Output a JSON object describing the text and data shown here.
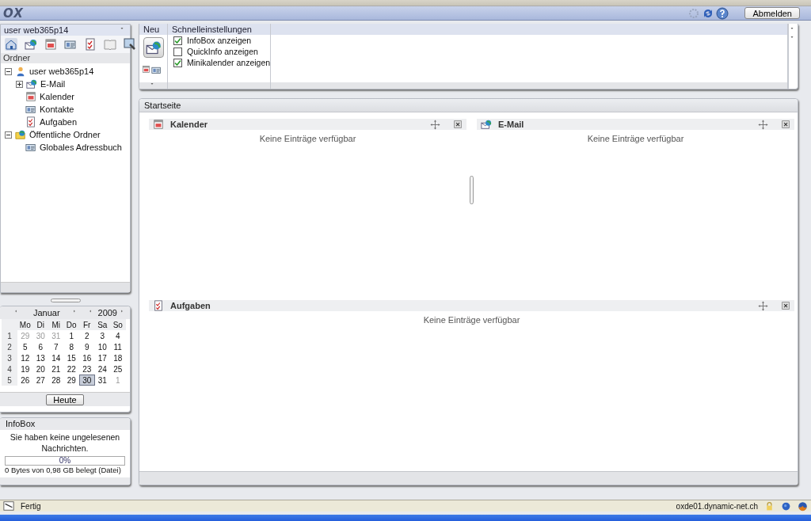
{
  "header": {
    "logo": "OX",
    "logout_button": "Abmelden"
  },
  "sidebar": {
    "account": "user web365p14",
    "folders_title": "Ordner",
    "tree": [
      {
        "label": "user web365p14",
        "kind": "user",
        "expanded": true,
        "children": [
          {
            "label": "E-Mail",
            "kind": "mail",
            "expanded": false
          },
          {
            "label": "Kalender",
            "kind": "calendar"
          },
          {
            "label": "Kontakte",
            "kind": "contacts"
          },
          {
            "label": "Aufgaben",
            "kind": "tasks"
          }
        ]
      },
      {
        "label": "Öffentliche Ordner",
        "kind": "public",
        "expanded": true,
        "children": [
          {
            "label": "Globales Adressbuch",
            "kind": "contacts"
          }
        ]
      }
    ]
  },
  "mini_calendar": {
    "month": "Januar",
    "year": "2009",
    "weekdays": [
      "Mo",
      "Di",
      "Mi",
      "Do",
      "Fr",
      "Sa",
      "So"
    ],
    "weeks": [
      {
        "number": "1",
        "days": [
          {
            "day": "29",
            "outside": true,
            "selected": false
          },
          {
            "day": "30",
            "outside": true,
            "selected": false
          },
          {
            "day": "31",
            "outside": true,
            "selected": false
          },
          {
            "day": "1",
            "outside": false,
            "selected": false
          },
          {
            "day": "2",
            "outside": false,
            "selected": false
          },
          {
            "day": "3",
            "outside": false,
            "selected": false
          },
          {
            "day": "4",
            "outside": false,
            "selected": false
          }
        ]
      },
      {
        "number": "2",
        "days": [
          {
            "day": "5",
            "outside": false,
            "selected": false
          },
          {
            "day": "6",
            "outside": false,
            "selected": false
          },
          {
            "day": "7",
            "outside": false,
            "selected": false
          },
          {
            "day": "8",
            "outside": false,
            "selected": false
          },
          {
            "day": "9",
            "outside": false,
            "selected": false
          },
          {
            "day": "10",
            "outside": false,
            "selected": false
          },
          {
            "day": "11",
            "outside": false,
            "selected": false
          }
        ]
      },
      {
        "number": "3",
        "days": [
          {
            "day": "12",
            "outside": false,
            "selected": false
          },
          {
            "day": "13",
            "outside": false,
            "selected": false
          },
          {
            "day": "14",
            "outside": false,
            "selected": false
          },
          {
            "day": "15",
            "outside": false,
            "selected": false
          },
          {
            "day": "16",
            "outside": false,
            "selected": false
          },
          {
            "day": "17",
            "outside": false,
            "selected": false
          },
          {
            "day": "18",
            "outside": false,
            "selected": false
          }
        ]
      },
      {
        "number": "4",
        "days": [
          {
            "day": "19",
            "outside": false,
            "selected": false
          },
          {
            "day": "20",
            "outside": false,
            "selected": false
          },
          {
            "day": "21",
            "outside": false,
            "selected": false
          },
          {
            "day": "22",
            "outside": false,
            "selected": false
          },
          {
            "day": "23",
            "outside": false,
            "selected": false
          },
          {
            "day": "24",
            "outside": false,
            "selected": false
          },
          {
            "day": "25",
            "outside": false,
            "selected": false
          }
        ]
      },
      {
        "number": "5",
        "days": [
          {
            "day": "26",
            "outside": false,
            "selected": false
          },
          {
            "day": "27",
            "outside": false,
            "selected": false
          },
          {
            "day": "28",
            "outside": false,
            "selected": false
          },
          {
            "day": "29",
            "outside": false,
            "selected": false
          },
          {
            "day": "30",
            "outside": false,
            "selected": true
          },
          {
            "day": "31",
            "outside": false,
            "selected": false
          },
          {
            "day": "1",
            "outside": true,
            "selected": false
          }
        ]
      }
    ],
    "today_button": "Heute"
  },
  "infobox": {
    "title": "InfoBox",
    "message": "Sie haben keine ungelesenen Nachrichten.",
    "quota": {
      "level": 0,
      "reading": "0%"
    },
    "usage": "0 Bytes von 0,98 GB belegt (Datei)"
  },
  "toolbar": {
    "new_label": "Neu",
    "quick_settings_title": "Schnelleinstellungen",
    "settings": [
      {
        "label": "InfoBox anzeigen",
        "checked": true
      },
      {
        "label": "QuickInfo anzeigen",
        "checked": false
      },
      {
        "label": "Minikalender anzeigen",
        "checked": true
      }
    ]
  },
  "portal": {
    "title": "Startseite",
    "top_row": [
      {
        "title": "Kalender",
        "kind": "calendar",
        "empty_text": "Keine Einträge verfügbar"
      },
      {
        "title": "E-Mail",
        "kind": "mail",
        "empty_text": "Keine Einträge verfügbar"
      }
    ],
    "bottom_row": [
      {
        "title": "Aufgaben",
        "kind": "tasks",
        "empty_text": "Keine Einträge verfügbar"
      }
    ]
  },
  "status_bar": {
    "text": "Fertig",
    "host": "oxde01.dynamic-net.ch"
  }
}
